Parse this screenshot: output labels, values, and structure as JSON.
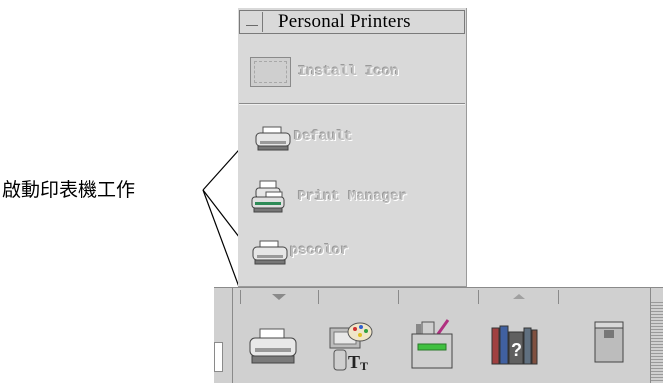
{
  "callout_label": "啟動印表機工作",
  "subpanel": {
    "title": "Personal Printers",
    "install_icon_label": "Install Icon",
    "printers": [
      {
        "label": "Default",
        "icon": "printer-icon"
      },
      {
        "label": "Print Manager",
        "icon": "print-manager-icon"
      },
      {
        "label": "pscolor",
        "icon": "printer-icon"
      }
    ]
  },
  "front_panel": {
    "icons": [
      {
        "name": "printer-icon"
      },
      {
        "name": "style-manager-icon"
      },
      {
        "name": "application-manager-icon"
      },
      {
        "name": "help-manager-icon"
      },
      {
        "name": "trash-icon"
      }
    ]
  },
  "colors": {
    "panel": "#d0d0d0",
    "subpanel": "#d9d9d9",
    "etched_text": "#bfbfbf"
  }
}
